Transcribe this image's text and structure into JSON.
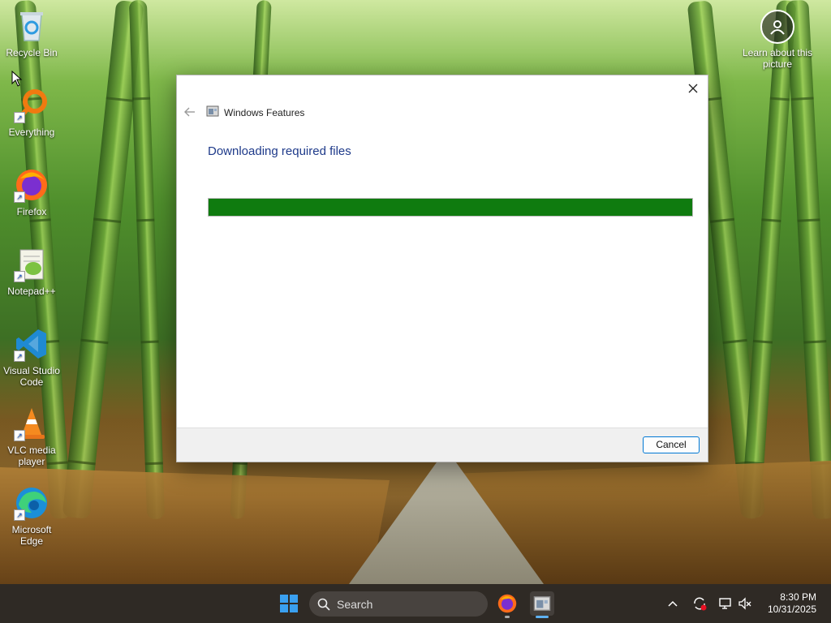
{
  "desktop": {
    "icons": [
      {
        "label": "Recycle Bin",
        "icon": "recycle-bin-icon"
      },
      {
        "label": "Everything",
        "icon": "everything-search-icon"
      },
      {
        "label": "Firefox",
        "icon": "firefox-icon"
      },
      {
        "label": "Notepad++",
        "icon": "notepad-plus-plus-icon"
      },
      {
        "label": "Visual Studio Code",
        "icon": "vscode-icon"
      },
      {
        "label": "VLC media player",
        "icon": "vlc-icon"
      },
      {
        "label": "Microsoft Edge",
        "icon": "edge-icon"
      }
    ],
    "learn": {
      "label": "Learn about this picture",
      "icon": "learn-picture-icon"
    }
  },
  "dialog": {
    "title": "Windows Features",
    "heading": "Downloading required files",
    "progress": 1.0,
    "progress_color": "#0f7b0f",
    "cancel_label": "Cancel",
    "title_icon": "windows-features-icon"
  },
  "taskbar": {
    "search_placeholder": "Search",
    "apps": [
      {
        "name": "firefox",
        "icon": "firefox-icon"
      },
      {
        "name": "windows-features",
        "icon": "windows-features-icon",
        "active": true
      }
    ],
    "clock": {
      "time": "8:30 PM",
      "date": "10/31/2025"
    },
    "tray_icons": [
      "chevron-up-icon",
      "sync-alert-icon",
      "network-icon",
      "volume-muted-icon"
    ]
  },
  "colors": {
    "accent": "#0078d4",
    "heading": "#1e3a8a",
    "taskbar": "#26211c"
  }
}
